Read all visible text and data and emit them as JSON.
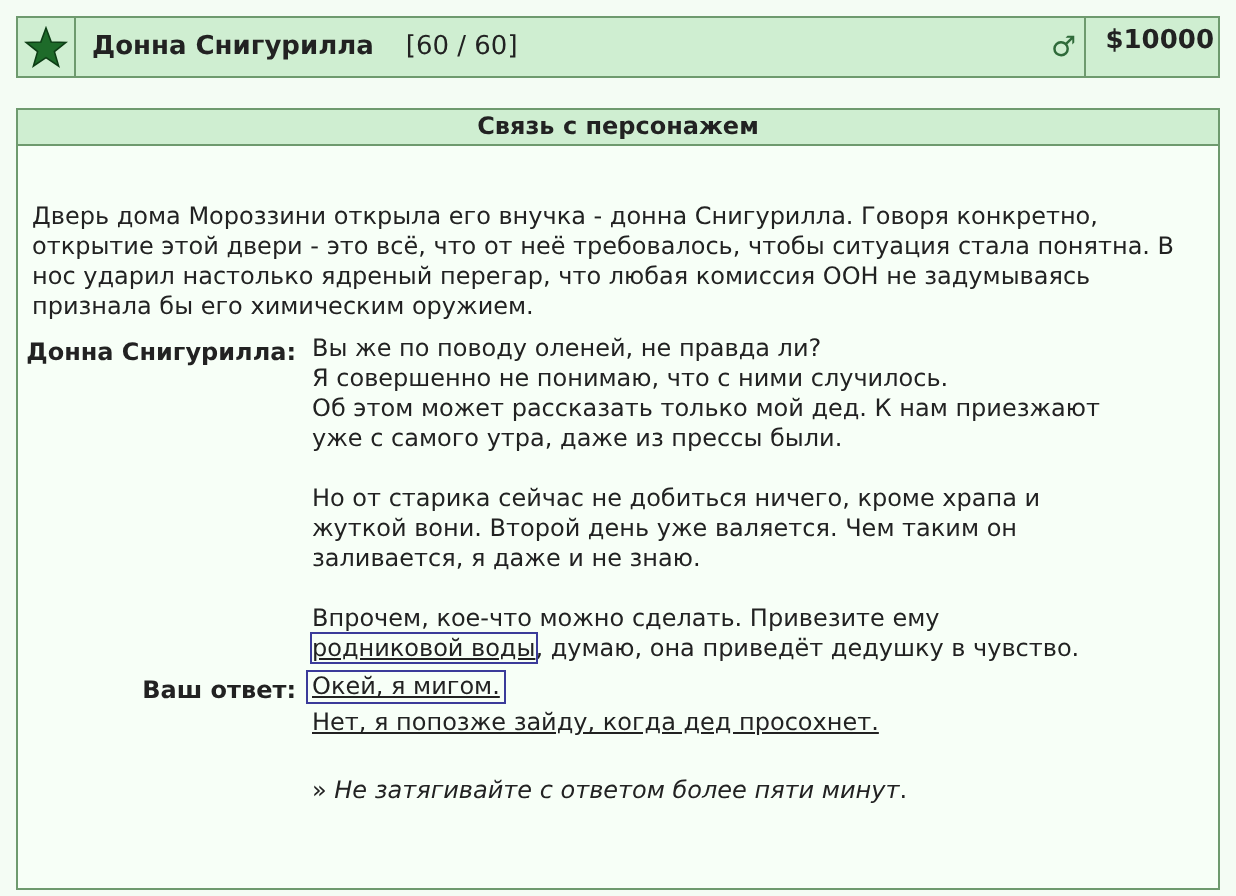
{
  "header": {
    "name": "Донна Снигурилла",
    "hp": "[60 / 60]",
    "gender_symbol": "♂",
    "money": "$10000"
  },
  "panel": {
    "title": "Связь с персонажем",
    "intro": "Дверь дома Мороззини открыла его внучка - донна Снигурилла. Говоря конкретно, открытие этой двери - это всё, что от неё требовалось, чтобы ситуация стала понятна. В нос ударил настолько ядреный перегар, что любая комиссия ООН не задумываясь признала бы его химическим оружием.",
    "speaker": "Донна Снигурилла:",
    "paragraphs": [
      {
        "text": "Вы же по поводу оленей, не правда ли?\nЯ совершенно не понимаю, что с ними случилось.\nОб этом может рассказать только мой дед. К нам приезжают уже с самого утра, даже из прессы были."
      },
      {
        "text": "Но от старика сейчас не добиться ничего, кроме храпа и жуткой вони. Второй день уже валяется. Чем таким он заливается, я даже и не знаю."
      },
      {
        "text": "Впрочем, кое-что можно сделать. Привезите ему",
        "link": {
          "label": "родниковой воды",
          "selected": true
        },
        "after": ", думаю, она приведёт дедушку в чувство."
      }
    ],
    "answer_label": "Ваш ответ:",
    "answers": [
      {
        "label": "Окей, я мигом.",
        "selected": true
      },
      {
        "label": "Нет, я попозже зайду, когда дед просохнет.",
        "selected": false
      }
    ],
    "note": "» *Не затягивайте с ответом более пяти минут*."
  }
}
